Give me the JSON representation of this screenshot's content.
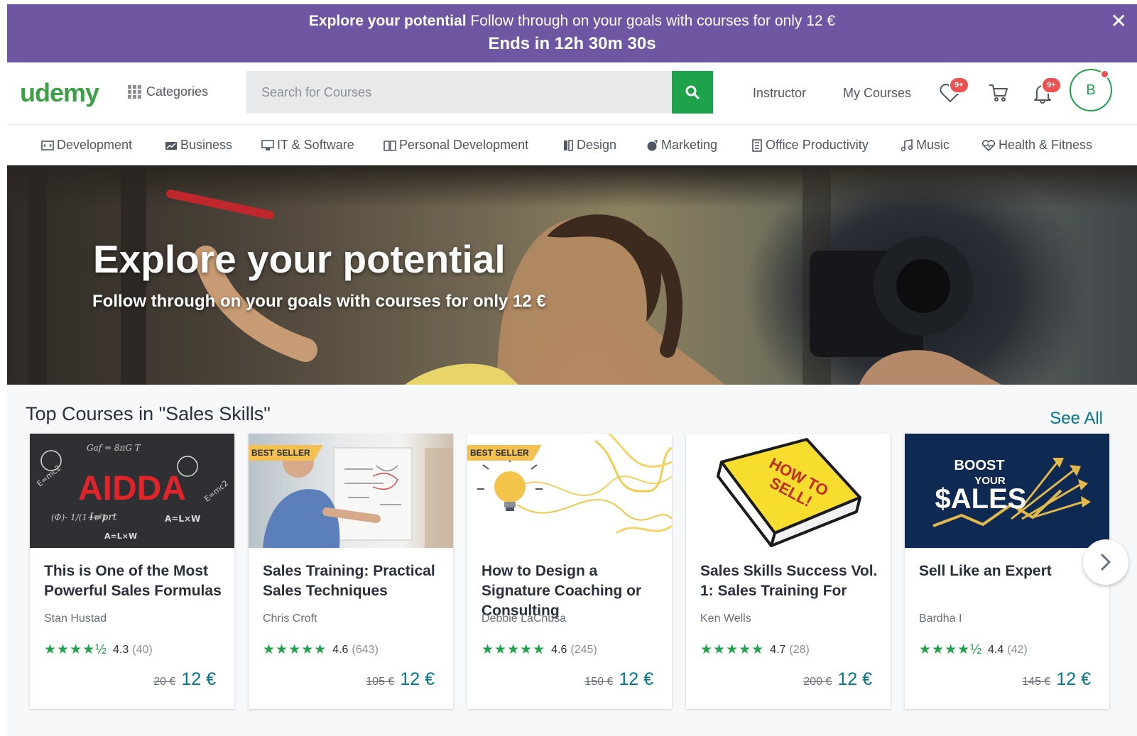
{
  "promo": {
    "headline_bold": "Explore your potential",
    "headline_rest": "Follow through on your goals with courses for only 12 €",
    "countdown": "Ends in 12h 30m 30s",
    "close_label": "✕"
  },
  "header": {
    "logo": "udemy",
    "categories_label": "Categories",
    "search_placeholder": "Search for Courses",
    "instructor_label": "Instructor",
    "my_courses_label": "My Courses",
    "wishlist_badge": "9+",
    "notifications_badge": "9+",
    "avatar_initial": "B"
  },
  "catnav": {
    "items": [
      {
        "label": "Development",
        "icon": "monitor-code-icon"
      },
      {
        "label": "Business",
        "icon": "chart-icon"
      },
      {
        "label": "IT & Software",
        "icon": "computer-icon"
      },
      {
        "label": "Personal Development",
        "icon": "book-icon"
      },
      {
        "label": "Design",
        "icon": "palette-icon"
      },
      {
        "label": "Marketing",
        "icon": "megaphone-icon"
      },
      {
        "label": "Office Productivity",
        "icon": "document-icon"
      },
      {
        "label": "Music",
        "icon": "music-note-icon"
      },
      {
        "label": "Health & Fitness",
        "icon": "heart-pulse-icon"
      }
    ]
  },
  "hero": {
    "title": "Explore your potential",
    "subtitle": "Follow through on your goals with courses for only 12 €"
  },
  "section": {
    "title": "Top Courses in \"Sales Skills\"",
    "see_all": "See All"
  },
  "courses": [
    {
      "title": "This is One of the Most Powerful Sales Formulas",
      "author": "Stan Hustad",
      "stars": "★★★★½",
      "rating": "4.3",
      "count": "(40)",
      "old_price": "20 €",
      "price": "12 €",
      "best_seller": "",
      "thumb_text": "AIDDA"
    },
    {
      "title": "Sales Training: Practical Sales Techniques",
      "author": "Chris Croft",
      "stars": "★★★★★",
      "rating": "4.6",
      "count": "(643)",
      "old_price": "105 €",
      "price": "12 €",
      "best_seller": "BEST SELLER",
      "thumb_text": ""
    },
    {
      "title": "How to Design a Signature Coaching or Consulting",
      "author": "Debbie LaChusa",
      "stars": "★★★★★",
      "rating": "4.6",
      "count": "(245)",
      "old_price": "150 €",
      "price": "12 €",
      "best_seller": "BEST SELLER",
      "thumb_text": ""
    },
    {
      "title": "Sales Skills Success Vol. 1: Sales Training For",
      "author": "Ken Wells",
      "stars": "★★★★★",
      "rating": "4.7",
      "count": "(28)",
      "old_price": "200 €",
      "price": "12 €",
      "best_seller": "",
      "thumb_text": "HOW TO SELL!"
    },
    {
      "title": "Sell Like an Expert",
      "author": "Bardha I",
      "stars": "★★★★½",
      "rating": "4.4",
      "count": "(42)",
      "old_price": "145 €",
      "price": "12 €",
      "best_seller": "",
      "thumb_text_1": "BOOST",
      "thumb_text_2": "YOUR",
      "thumb_text_3": "$ALES"
    }
  ],
  "colors": {
    "promo_bg": "#6f56a3",
    "brand_green": "#1ea34a",
    "price_blue": "#007791",
    "badge_red": "#ec5252",
    "best_seller_yellow": "#f4c150"
  }
}
